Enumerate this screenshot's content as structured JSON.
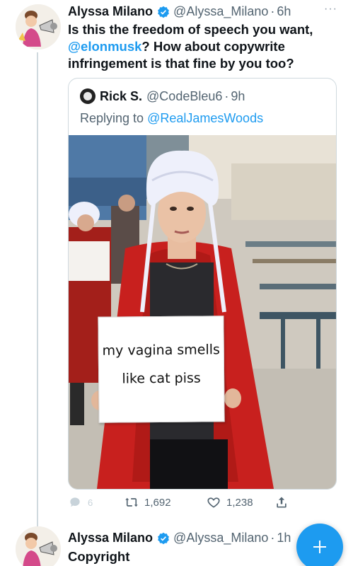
{
  "tweet1": {
    "name": "Alyssa Milano",
    "handle": "@Alyssa_Milano",
    "time": "6h",
    "text_lines": [
      "Is this the freedom of speech you want,",
      "@elonmusk",
      "? How about copywrite",
      "infringement is that fine by you too?"
    ],
    "more": "···"
  },
  "quote": {
    "name": "Rick S.",
    "handle": "@CodeBleu6",
    "time": "9h",
    "replying_prefix": "Replying to",
    "replying_to": "@RealJamesWoods",
    "sign_lines": [
      "my vagina smells",
      "like cat piss"
    ]
  },
  "actions": {
    "reply_count": "6",
    "retweet_count": "1,692",
    "like_count": "1,238"
  },
  "tweet2": {
    "name": "Alyssa Milano",
    "handle": "@Alyssa_Milano",
    "time": "1h",
    "text": "Copyright"
  },
  "dot": "·",
  "colors": {
    "accent": "#1d9bf0",
    "text": "#0f1419",
    "secondary": "#536471",
    "border": "#cfd9de",
    "cape": "#c8201e",
    "bonnet": "#eef0fb"
  },
  "icons": [
    "verified-badge-icon",
    "more-icon",
    "reply-icon",
    "retweet-icon",
    "like-icon",
    "share-icon",
    "compose-plus-icon"
  ]
}
